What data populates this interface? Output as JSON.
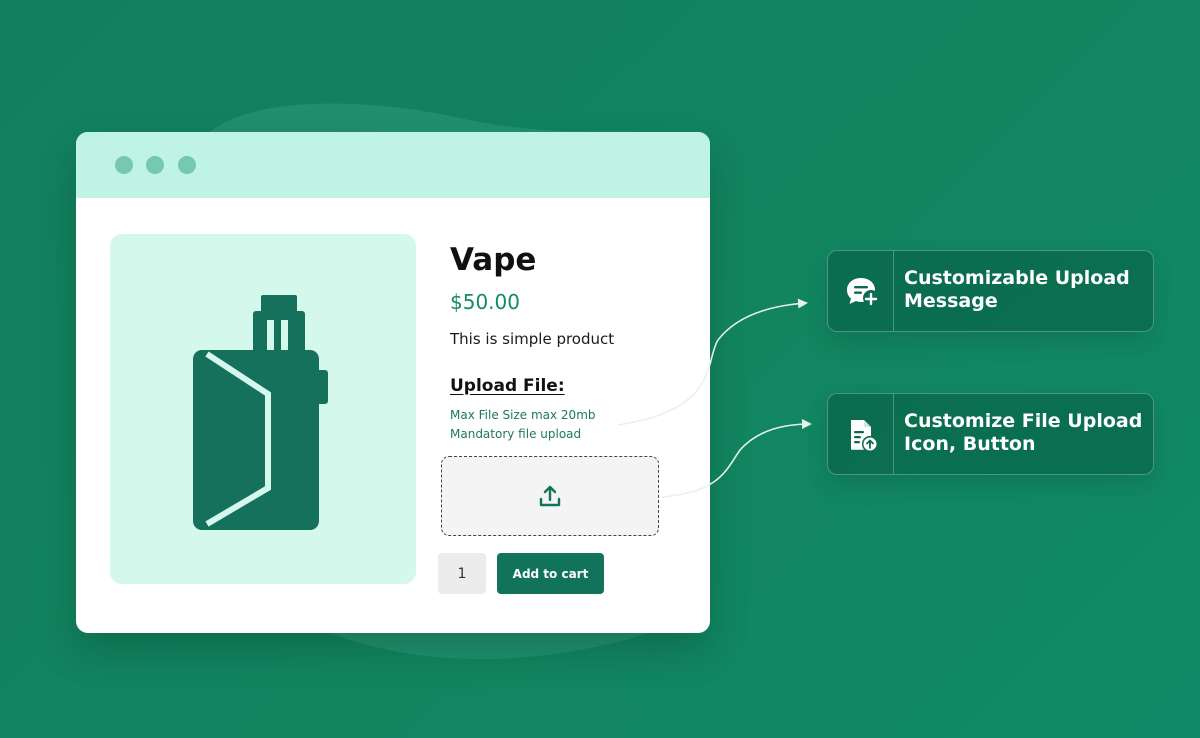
{
  "product": {
    "title": "Vape",
    "price": "$50.00",
    "description": "This is simple product"
  },
  "upload": {
    "heading": "Upload File:",
    "max_size_note": "Max File Size max 20mb",
    "mandatory_note": "Mandatory file upload",
    "icon": "upload-icon"
  },
  "cart": {
    "quantity": "1",
    "add_to_cart_label": "Add to cart"
  },
  "features": [
    {
      "icon": "chat-add-icon",
      "line1": "Customizable Upload",
      "line2": "Message"
    },
    {
      "icon": "file-upload-icon",
      "line1": "Customize File Upload",
      "line2": "Icon, Button"
    }
  ],
  "colors": {
    "background": "#12805e",
    "titlebar": "#bff4e4",
    "window_dot": "#76c8b1",
    "image_panel": "#d4f8ec",
    "product_graphic": "#15705c",
    "price": "#138a66",
    "primary_button": "#11735a"
  }
}
